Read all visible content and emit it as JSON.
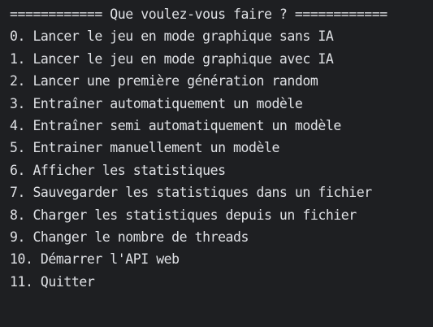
{
  "terminal": {
    "header": "============ Que voulez-vous faire ? ============",
    "options": [
      "0. Lancer le jeu en mode graphique sans IA",
      "1. Lancer le jeu en mode graphique avec IA",
      "2. Lancer une première génération random",
      "3. Entraîner automatiquement un modèle",
      "4. Entraîner semi automatiquement un modèle",
      "5. Entrainer manuellement un modèle",
      "6. Afficher les statistiques",
      "7. Sauvegarder les statistiques dans un fichier",
      "8. Charger les statistiques depuis un fichier",
      "9. Changer le nombre de threads",
      "10. Démarrer l'API web",
      "11. Quitter"
    ]
  },
  "colors": {
    "background": "#1e1f22",
    "text": "#dfe1e5"
  }
}
